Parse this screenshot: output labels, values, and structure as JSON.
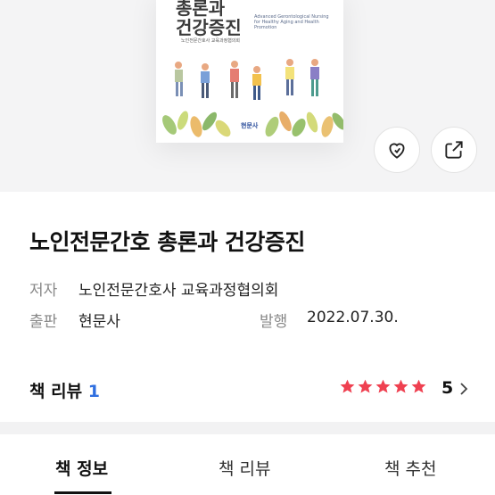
{
  "cover": {
    "title": "총론과\n건강증진",
    "subtitle": "Advanced Gerontological Nursing for Healthy Aging and Health Promotion",
    "author_line": "노인전문간호사 교육과정협의회",
    "publisher": "현문사"
  },
  "actions": {
    "like_icon": "heart-icon",
    "share_icon": "share-icon"
  },
  "book": {
    "title": "노인전문간호 총론과 건강증진",
    "author_label": "저자",
    "author": "노인전문간호사 교육과정협의회",
    "publisher_label": "출판",
    "publisher": "현문사",
    "date_label": "발행",
    "date": "2022.07.30."
  },
  "review": {
    "label": "책 리뷰",
    "count": "1",
    "rating": "5",
    "stars": 5,
    "star_color": "#ef4050"
  },
  "tabs": [
    {
      "label": "책 정보",
      "active": true
    },
    {
      "label": "책 리뷰",
      "active": false
    },
    {
      "label": "책 추천",
      "active": false
    }
  ]
}
